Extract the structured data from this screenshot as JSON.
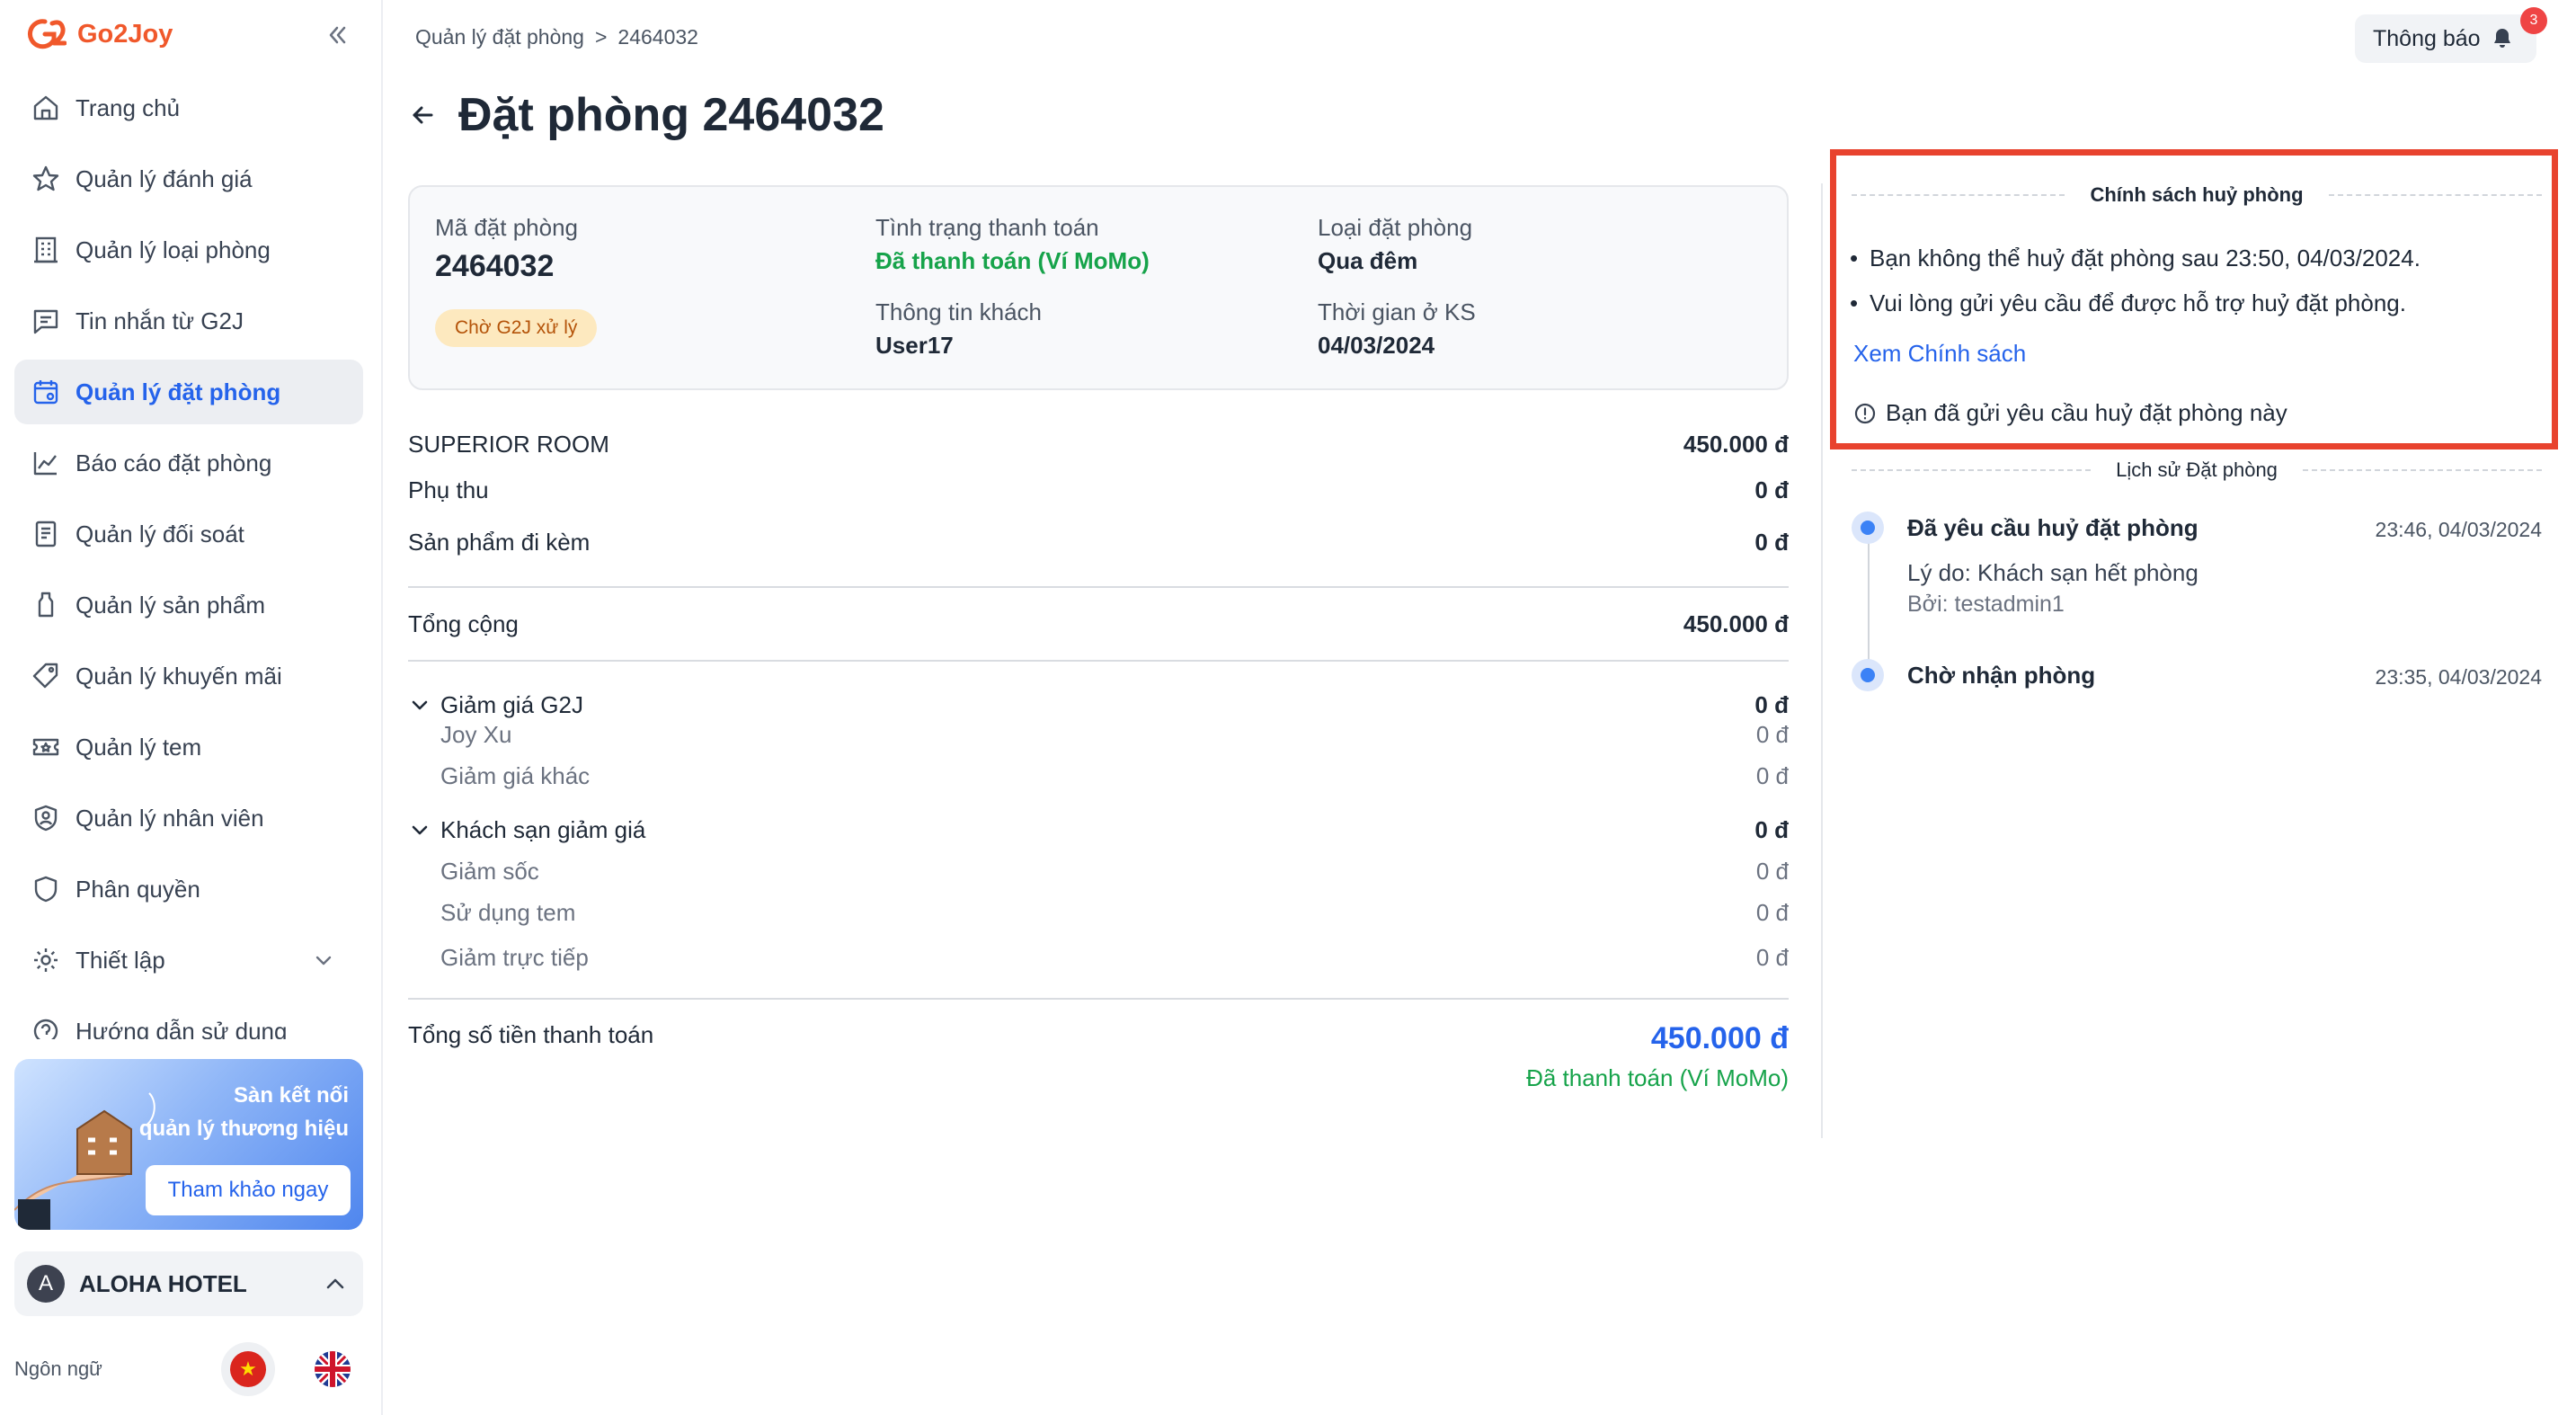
{
  "app": {
    "name": "Go2Joy"
  },
  "sidebar": {
    "items": [
      {
        "label": "Trang chủ",
        "icon": "home-icon"
      },
      {
        "label": "Quản lý đánh giá",
        "icon": "star-icon"
      },
      {
        "label": "Quản lý loại phòng",
        "icon": "building-icon"
      },
      {
        "label": "Tin nhắn từ G2J",
        "icon": "message-icon"
      },
      {
        "label": "Quản lý đặt phòng",
        "icon": "calendar-icon",
        "active": true
      },
      {
        "label": "Báo cáo đặt phòng",
        "icon": "chart-icon"
      },
      {
        "label": "Quản lý đối soát",
        "icon": "document-icon"
      },
      {
        "label": "Quản lý sản phẩm",
        "icon": "bottle-icon"
      },
      {
        "label": "Quản lý khuyến mãi",
        "icon": "tag-icon"
      },
      {
        "label": "Quản lý tem",
        "icon": "ticket-icon"
      },
      {
        "label": "Quản lý nhân viên",
        "icon": "user-shield-icon"
      },
      {
        "label": "Phân quyền",
        "icon": "shield-icon"
      },
      {
        "label": "Thiết lập",
        "icon": "gear-icon"
      },
      {
        "label": "Hướng dẫn sử dụng",
        "icon": "help-icon"
      }
    ],
    "banner": {
      "line1": "Sàn kết nối",
      "line2": "quản lý thương hiệu",
      "button": "Tham khảo ngay"
    },
    "hotel": {
      "initial": "A",
      "name": "ALOHA HOTEL"
    },
    "language_label": "Ngôn ngữ"
  },
  "header": {
    "breadcrumb": [
      "Quản lý đặt phòng",
      ">",
      "2464032"
    ],
    "notify_label": "Thông báo",
    "notify_count": "3",
    "title": "Đặt phòng 2464032"
  },
  "info": {
    "booking_code_label": "Mã đặt phòng",
    "booking_code": "2464032",
    "status": "Chờ G2J xử lý",
    "payment_status_label": "Tình trạng thanh toán",
    "payment_status": "Đã thanh toán (Ví MoMo)",
    "guest_label": "Thông tin khách",
    "guest": "User17",
    "booking_type_label": "Loại đặt phòng",
    "booking_type": "Qua đêm",
    "stay_time_label": "Thời gian ở KS",
    "stay_time": "04/03/2024"
  },
  "charges": {
    "room": {
      "label": "SUPERIOR ROOM",
      "amount": "450.000 đ"
    },
    "surcharge": {
      "label": "Phụ thu",
      "amount": "0 đ"
    },
    "addon": {
      "label": "Sản phẩm đi kèm",
      "amount": "0 đ"
    },
    "total": {
      "label": "Tổng cộng",
      "amount": "450.000 đ"
    },
    "g2j_discount": {
      "label": "Giảm giá G2J",
      "amount": "0 đ",
      "items": [
        {
          "label": "Joy Xu",
          "amount": "0 đ"
        },
        {
          "label": "Giảm giá khác",
          "amount": "0 đ"
        }
      ]
    },
    "hotel_discount": {
      "label": "Khách sạn giảm giá",
      "amount": "0 đ",
      "items": [
        {
          "label": "Giảm sốc",
          "amount": "0 đ"
        },
        {
          "label": "Sử dụng tem",
          "amount": "0 đ"
        },
        {
          "label": "Giảm trực tiếp",
          "amount": "0 đ"
        }
      ]
    },
    "grand_total": {
      "label": "Tổng số tiền thanh toán",
      "amount": "450.000 đ",
      "status": "Đã thanh toán (Ví MoMo)"
    }
  },
  "policy": {
    "title": "Chính sách huỷ phòng",
    "bullet1": "Bạn không thể huỷ đặt phòng sau 23:50, 04/03/2024.",
    "bullet2": "Vui lòng gửi yêu cầu để được hỗ trợ huỷ đặt phòng.",
    "link": "Xem Chính sách",
    "note": "Bạn đã gửi yêu cầu huỷ đặt phòng này"
  },
  "history": {
    "title": "Lịch sử Đặt phòng",
    "events": [
      {
        "title": "Đã yêu cầu huỷ đặt phòng",
        "time": "23:46, 04/03/2024",
        "reason": "Lý do: Khách sạn hết phòng",
        "by": "Bởi: testadmin1"
      },
      {
        "title": "Chờ nhận phòng",
        "time": "23:35, 04/03/2024"
      }
    ]
  },
  "colors": {
    "brand": "#f0582b",
    "accent": "#2563eb",
    "success": "#16a34a",
    "highlight": "#e8432e"
  }
}
